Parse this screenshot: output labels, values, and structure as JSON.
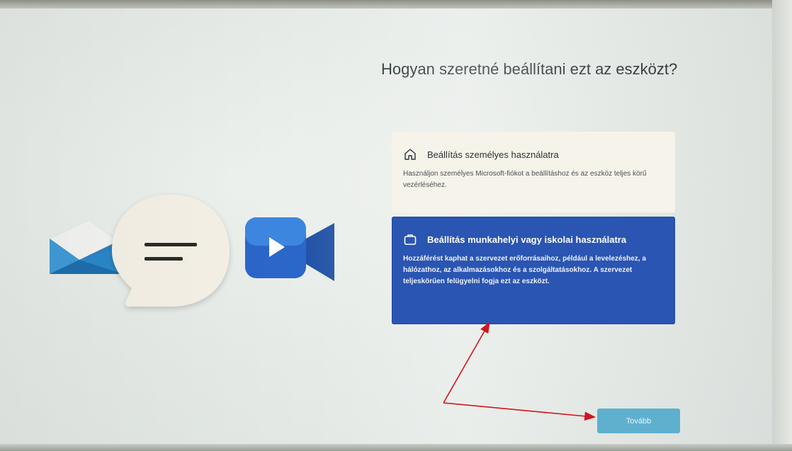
{
  "page": {
    "title": "Hogyan szeretné beállítani ezt az eszközt?"
  },
  "options": [
    {
      "icon": "home-icon",
      "title": "Beállítás személyes használatra",
      "description": "Használjon személyes Microsoft-fiókot a beállításhoz és az eszköz teljes körű vezérléséhez."
    },
    {
      "icon": "briefcase-icon",
      "title": "Beállítás munkahelyi vagy iskolai használatra",
      "description": "Hozzáférést kaphat a szervezet erőforrásaihoz, például a levelezéshez, a hálózathoz, az alkalmazásokhoz és a szolgáltatásokhoz. A szervezet teljeskörűen felügyelni fogja ezt az eszközt.",
      "selected": true
    }
  ],
  "footer": {
    "next_label": "Tovább"
  },
  "colors": {
    "selected_option": "#2a55b2",
    "next_button": "#5fb0cf",
    "annotation_arrow": "#d4141c"
  }
}
